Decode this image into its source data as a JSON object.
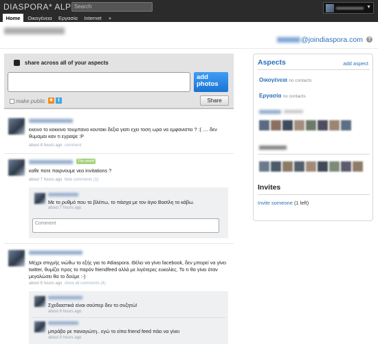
{
  "app": {
    "brand": "DIASPORA* ALPHA",
    "search_placeholder": "Search"
  },
  "nav": {
    "tabs": [
      {
        "label": "Home",
        "active": true
      },
      {
        "label": "Οικογένεια",
        "active": false
      },
      {
        "label": "Εργασία",
        "active": false
      },
      {
        "label": "Internet",
        "active": false
      },
      {
        "label": "+",
        "active": false
      }
    ]
  },
  "header": {
    "address_suffix": "@joindiaspora.com",
    "help_icon": "?"
  },
  "publisher": {
    "title": "share across all of your aspects",
    "text_value": "",
    "add_photos_label": "add photos",
    "make_public_label": "make public",
    "share_label": "Share",
    "rss_icon": "rss-icon",
    "twitter_icon": "twitter-icon"
  },
  "posts": [
    {
      "text": "εκεινο το κοκκινο τουμπανο κουτακι δεξια γιατι εχει τοση ωρα να εμφανιστει ? :( .... δεν θυμαμαι καν τι εγραψε :P",
      "time": "about 8 hours ago",
      "action": "comment"
    },
    {
      "badge": "The world",
      "text": "καθε ποτε παιρνουμε νεα invitations ?",
      "time": "about 7 hours ago",
      "action": "hide comments (1)",
      "comments": [
        {
          "text": "Με το ρυθμό που το βλέπω, το πάσχα με τον άγιο Βασίλη το κάβω.",
          "time": "about 7 hours ago"
        }
      ],
      "comment_placeholder": "Comment"
    },
    {
      "text": "Μέχρι στιγμής νιώθω το εξής για το #diaspora. Θέλει να γίνει facebook, δεν μπορεί να γίνει twitter, θυμίζει προς το παρόν friendfeed αλλά με λιγότερες ευκολίες. Το τι θα γίνει όταν μεγαλώσει θα το δούμε :-)",
      "time": "about 8 hours ago",
      "action": "show all comments (4)",
      "comments": [
        {
          "text": "Σχεδιαστικά είναι σούπερ δεν το συζητώ!",
          "time": "about 8 hours ago"
        },
        {
          "text": "μπράβο ρε παναγιώτη.. εγώ το είπα friend feed πάει να γίνει",
          "time": "about 8 hours ago"
        }
      ]
    }
  ],
  "sidebar": {
    "aspects_title": "Aspects",
    "add_aspect": "add aspect",
    "aspects": [
      {
        "name": "Οικογένεια",
        "status": "no contacts"
      },
      {
        "name": "Εργασία",
        "status": "no contacts"
      }
    ],
    "invites_title": "Invites",
    "invite_link": "Invite someone",
    "invite_count": "(1 left)"
  },
  "colors": {
    "topbar": "#2b2b2b",
    "link": "#2a6fb8",
    "add_photos": "#1a73d2"
  }
}
